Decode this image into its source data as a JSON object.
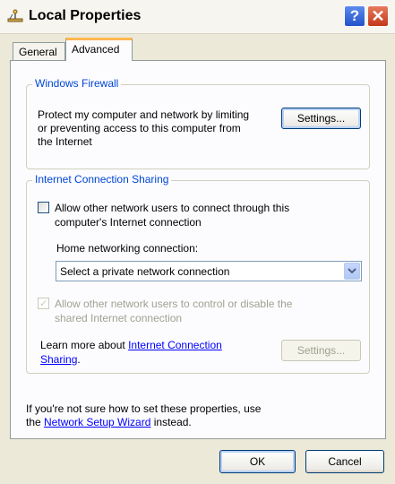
{
  "window": {
    "title": "Local Properties",
    "help_label": "?",
    "close_label": "✕"
  },
  "tabs": [
    {
      "label": "General",
      "active": false
    },
    {
      "label": "Advanced",
      "active": true
    }
  ],
  "firewall": {
    "group_title": "Windows Firewall",
    "description_line1": "Protect my computer and network by limiting",
    "description_line2": "or preventing access to this computer from",
    "description_line3": "the Internet",
    "settings_button": "Settings..."
  },
  "sharing": {
    "group_title": "Internet Connection Sharing",
    "allow_connect_line1": "Allow other network users to connect through this",
    "allow_connect_line2": "computer's Internet connection",
    "allow_connect_checked": false,
    "home_network_label": "Home networking connection:",
    "home_network_value": "Select a private network connection",
    "allow_control_line1": "Allow other network users to control or disable the",
    "allow_control_line2": "shared Internet connection",
    "allow_control_checked": true,
    "learn_more_prefix": "Learn more about ",
    "learn_more_link_part1": "Internet Connection",
    "learn_more_link_part2": "Sharing",
    "learn_more_suffix": ".",
    "settings_button": "Settings..."
  },
  "footer": {
    "help_line1": "If you're not sure how to set these properties, use",
    "help_prefix": "the ",
    "wizard_link": "Network Setup Wizard",
    "help_suffix": " instead."
  },
  "buttons": {
    "ok": "OK",
    "cancel": "Cancel"
  },
  "colors": {
    "dialog_background": "#ece9d8",
    "group_title": "#0046d5",
    "link": "#0000ff",
    "tab_highlight": "#fdb74f"
  }
}
